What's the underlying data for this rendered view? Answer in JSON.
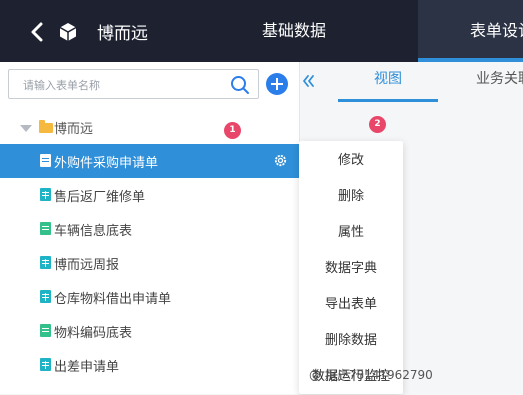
{
  "header": {
    "app_name": "博而远",
    "tabs": [
      {
        "label": "基础数据"
      },
      {
        "label": "表单设计"
      }
    ]
  },
  "sidebar": {
    "search_placeholder": "请输入表单名称",
    "root": {
      "label": "博而远"
    },
    "items": [
      {
        "label": "外购件采购申请单",
        "icon": "doc-icon",
        "color": "#ffffff",
        "selected": true
      },
      {
        "label": "售后返厂维修单",
        "icon": "grid-doc-icon",
        "color": "#1fb3c6"
      },
      {
        "label": "车辆信息底表",
        "icon": "doc-icon",
        "color": "#33c08a"
      },
      {
        "label": "博而远周报",
        "icon": "grid-doc-icon",
        "color": "#1fb3c6"
      },
      {
        "label": "仓库物料借出申请单",
        "icon": "grid-doc-icon",
        "color": "#1fb3c6"
      },
      {
        "label": "物料编码底表",
        "icon": "doc-icon",
        "color": "#33c08a"
      },
      {
        "label": "出差申请单",
        "icon": "grid-doc-icon",
        "color": "#1fb3c6"
      }
    ]
  },
  "content": {
    "tabs": [
      {
        "label": "视图"
      },
      {
        "label": "业务关联"
      }
    ]
  },
  "context_menu": {
    "items": [
      {
        "label": "修改"
      },
      {
        "label": "删除"
      },
      {
        "label": "属性"
      },
      {
        "label": "数据字典"
      },
      {
        "label": "导出表单"
      },
      {
        "label": "删除数据"
      },
      {
        "label": "数据运行监控"
      }
    ]
  },
  "badges": [
    "1",
    "2"
  ],
  "watermark": "@ 用户78141962790"
}
